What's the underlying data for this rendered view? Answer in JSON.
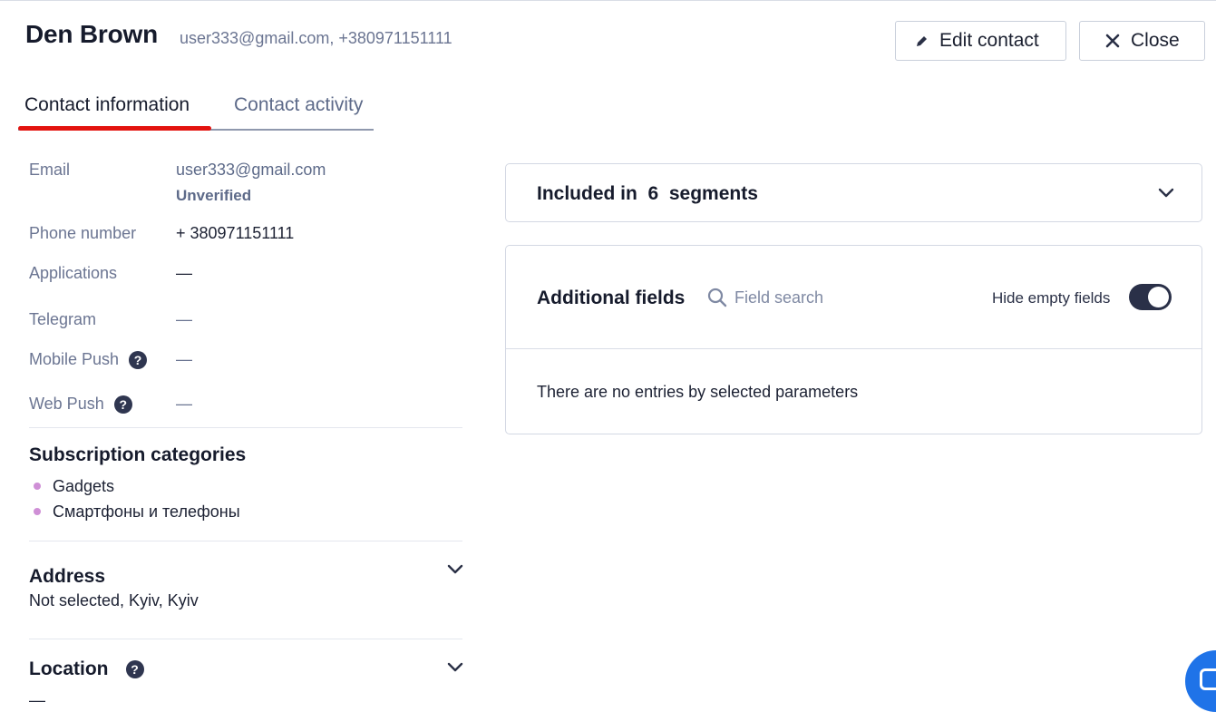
{
  "header": {
    "name": "Den Brown",
    "meta": "user333@gmail.com, +380971151111",
    "edit_label": "Edit contact",
    "close_label": "Close"
  },
  "tabs": [
    {
      "label": "Contact information",
      "active": true
    },
    {
      "label": "Contact activity",
      "active": false
    }
  ],
  "info": {
    "email_label": "Email",
    "email_value": "user333@gmail.com",
    "email_status": "Unverified",
    "phone_label": "Phone number",
    "phone_value": "+ 380971151111",
    "applications_label": "Applications",
    "applications_value": "—",
    "telegram_label": "Telegram",
    "telegram_value": "—",
    "mobile_push_label": "Mobile Push",
    "mobile_push_value": "—",
    "web_push_label": "Web Push",
    "web_push_value": "—"
  },
  "subscriptions": {
    "title": "Subscription categories",
    "items": [
      "Gadgets",
      "Смартфоны и телефоны"
    ]
  },
  "address": {
    "title": "Address",
    "value": "Not selected, Kyiv, Kyiv"
  },
  "location": {
    "title": "Location",
    "value": "—"
  },
  "segments": {
    "prefix": "Included in",
    "count": "6",
    "suffix": "segments"
  },
  "additional_fields": {
    "title": "Additional fields",
    "search_placeholder": "Field search",
    "hide_empty_label": "Hide empty fields",
    "hide_empty_on": true,
    "empty_message": "There are no entries by selected parameters"
  },
  "colors": {
    "accent": "#e3130f",
    "toggle": "#2a3048",
    "chat": "#1f73e8",
    "bullet": "#cf8fd6"
  }
}
